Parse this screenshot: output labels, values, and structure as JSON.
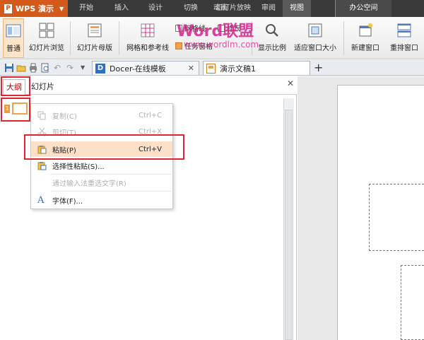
{
  "app": {
    "name": "WPS 演示",
    "logo_letter": "P"
  },
  "menu": {
    "tabs": [
      "开始",
      "插入",
      "设计",
      "切换",
      "动画",
      "幻灯片放映",
      "审阅",
      "视图"
    ],
    "active_tab": "视图",
    "office_space": "办公空间"
  },
  "ribbon": {
    "normal": "普通",
    "slide_browse": "幻灯片浏览",
    "slide_master": "幻灯片母版",
    "grid_guides": "网格和参考线",
    "grid_lines": "网格线",
    "ruler": "标尺",
    "task_pane": "任务窗格",
    "zoom": "显示比例",
    "fit_window": "适应窗口大小",
    "new_window": "新建窗口",
    "arrange": "重排窗口"
  },
  "watermark": {
    "brand": "Word联盟",
    "url": "www.wordlm.com"
  },
  "doc_tabs": [
    {
      "label": "Docer-在线模板"
    },
    {
      "label": "演示文稿1"
    }
  ],
  "pane": {
    "tab_outline": "大纲",
    "tab_slides": "幻灯片",
    "slide_number": "1"
  },
  "context_menu": {
    "items": [
      {
        "label": "复制(C)",
        "shortcut": "Ctrl+C",
        "enabled": false
      },
      {
        "label": "剪切(T)",
        "shortcut": "Ctrl+X",
        "enabled": false
      },
      {
        "label": "粘贴(P)",
        "shortcut": "Ctrl+V",
        "enabled": true
      },
      {
        "label": "选择性粘贴(S)...",
        "shortcut": "",
        "enabled": true
      },
      {
        "label": "通过输入法重选文字(R)",
        "shortcut": "",
        "enabled": false
      },
      {
        "label": "字体(F)...",
        "shortcut": "",
        "enabled": true
      }
    ]
  },
  "colors": {
    "accent": "#d45a1c",
    "highlight": "#fce0c8",
    "annotation_red": "#e0262f"
  }
}
